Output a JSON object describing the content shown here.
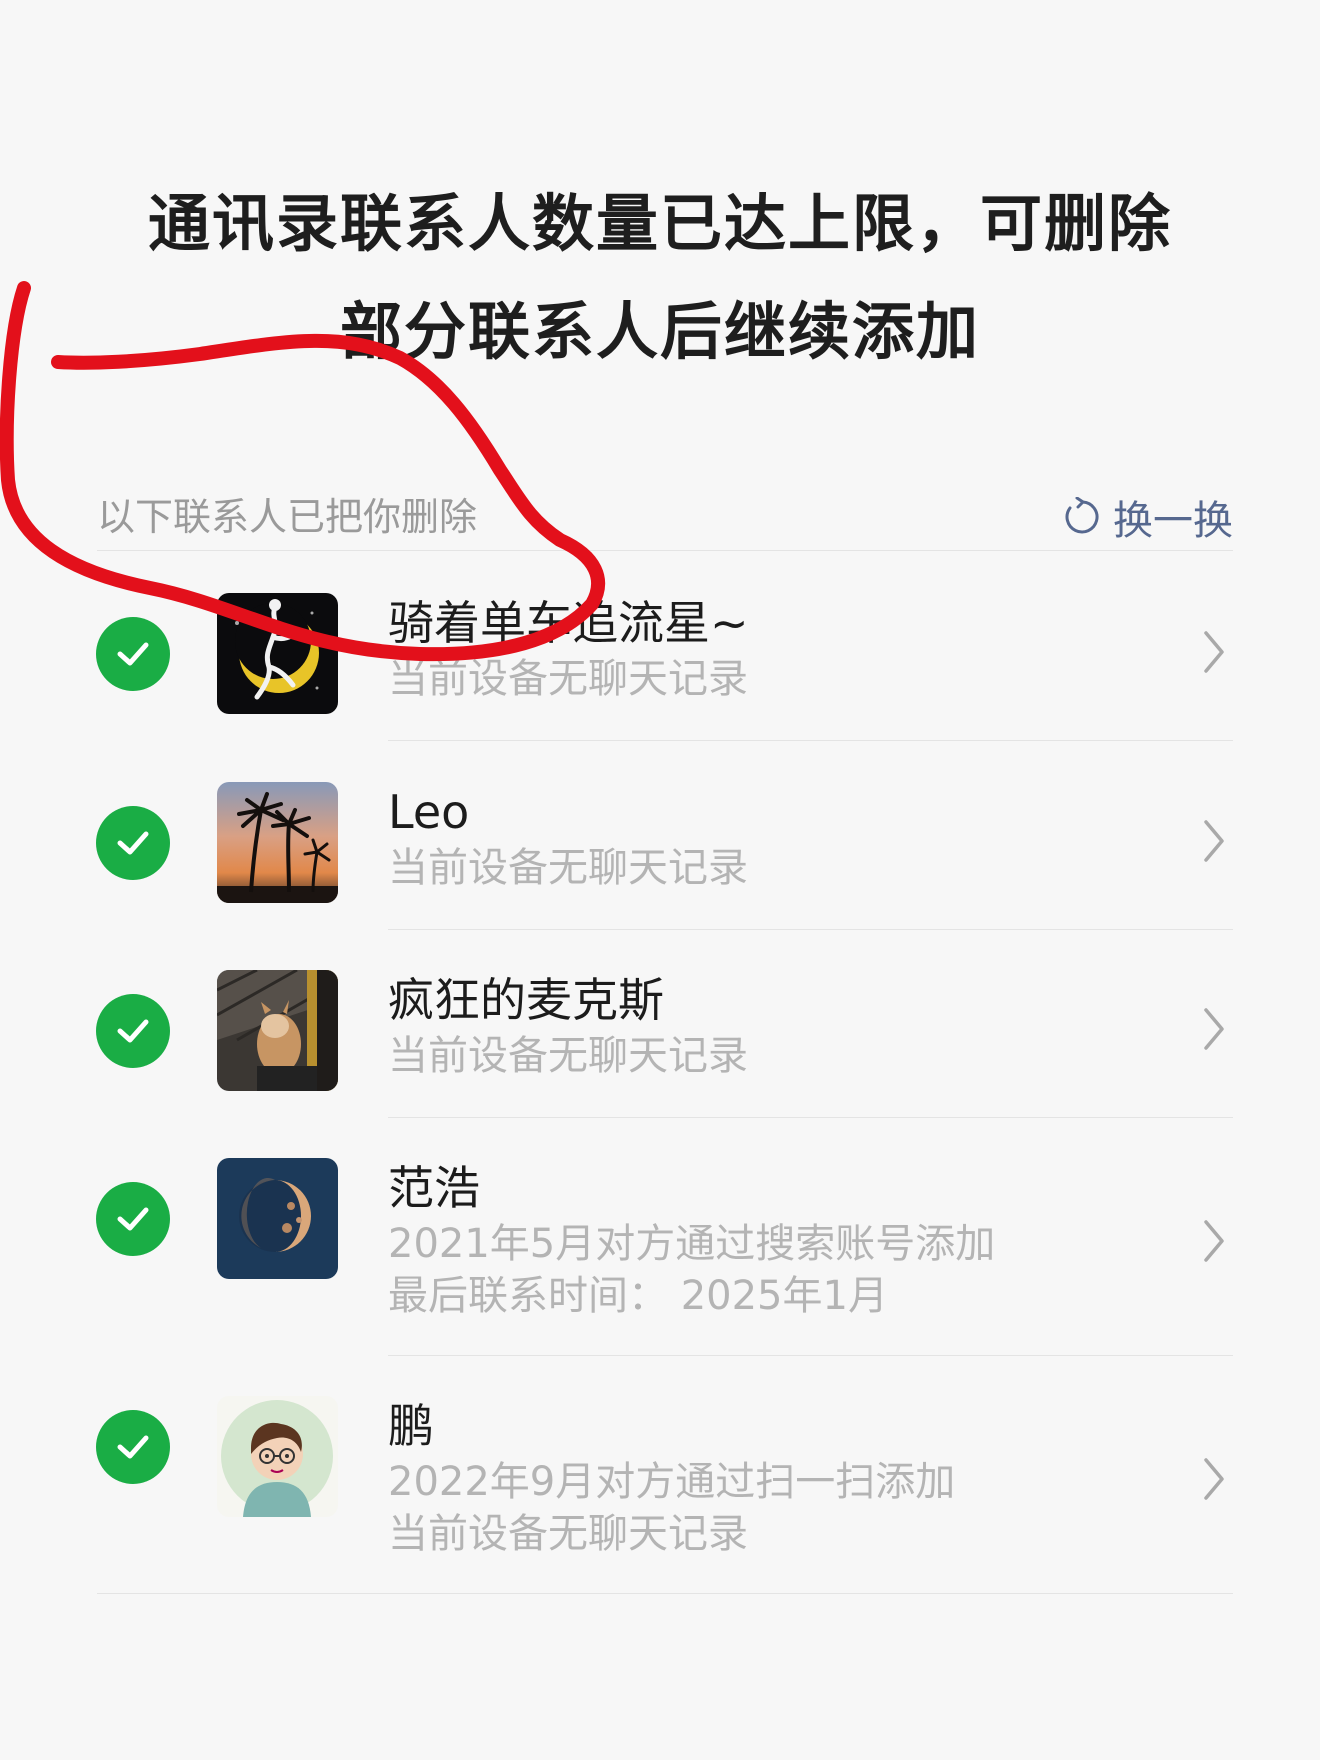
{
  "title": {
    "line1": "通讯录联系人数量已达上限，可删除",
    "line2": "部分联系人后继续添加"
  },
  "section": {
    "label": "以下联系人已把你删除",
    "refresh_label": "换一换",
    "refresh_icon": "refresh-icon"
  },
  "contacts": [
    {
      "name": "骑着单车追流星~",
      "line1": "当前设备无聊天记录",
      "line2": "",
      "checked": true,
      "avatar": "moon-silhouette-avatar"
    },
    {
      "name": "Leo",
      "line1": "当前设备无聊天记录",
      "line2": "",
      "checked": true,
      "avatar": "palm-sunset-avatar"
    },
    {
      "name": "疯狂的麦克斯",
      "line1": "当前设备无聊天记录",
      "line2": "",
      "checked": true,
      "avatar": "dog-photo-avatar"
    },
    {
      "name": "范浩",
      "line1": "2021年5月对方通过搜索账号添加",
      "line2": "最后联系时间： 2025年1月",
      "checked": true,
      "avatar": "half-moon-avatar"
    },
    {
      "name": "鹏",
      "line1": "2022年9月对方通过扫一扫添加",
      "line2": "当前设备无聊天记录",
      "checked": true,
      "avatar": "cartoon-boy-avatar"
    }
  ],
  "colors": {
    "check_green": "#1aad45",
    "link_blue": "#56688f",
    "annotation_red": "#e3101b"
  }
}
